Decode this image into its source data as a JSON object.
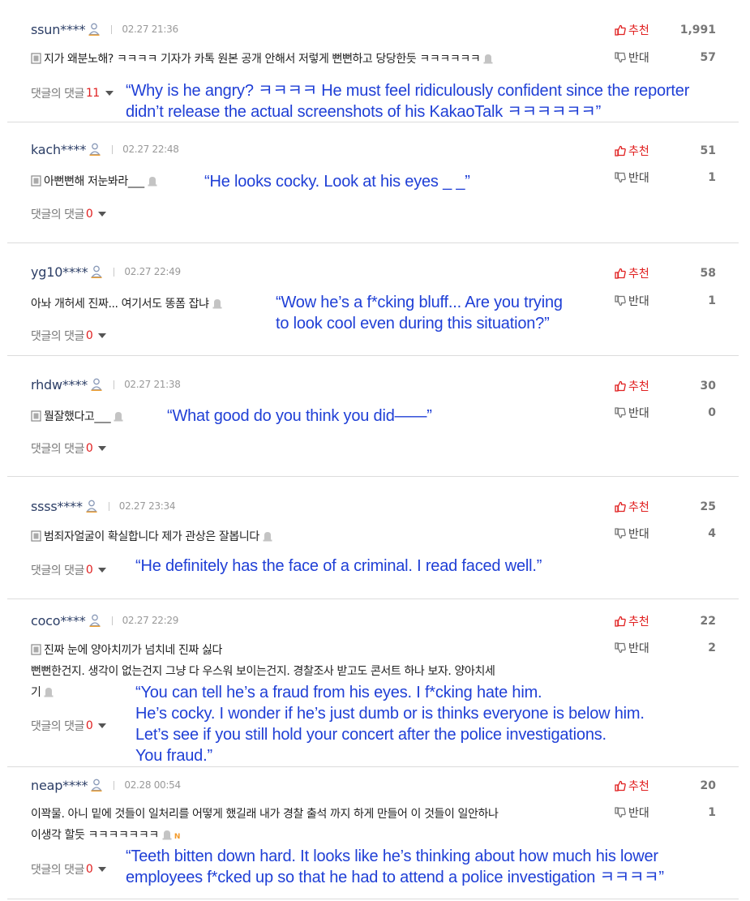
{
  "labels": {
    "recommend": "추천",
    "oppose": "반대",
    "replies": "댓글의 댓글"
  },
  "colors": {
    "username": "#2c3e66",
    "recommend": "#e02020",
    "reply_count": "#e02020",
    "translation": "#1f3fd6",
    "badge_n": "#f39a2a"
  },
  "comments": [
    {
      "user": "ssun****",
      "date": "02.27 21:36",
      "up": "1,991",
      "down": "57",
      "lines": [
        "지가 왜분노해? ㅋㅋㅋㅋ 기자가 카톡 원본 공개 안해서 저렇게 뻔뻔하고 당당한듯 ㅋㅋㅋㅋㅋㅋ"
      ],
      "replies": "11",
      "translation": [
        "“Why is he angry? ㅋㅋㅋㅋ He must feel ridiculously confident since the reporter",
        "didn’t release the actual screenshots of his KakaoTalk ㅋㅋㅋㅋㅋㅋ”"
      ]
    },
    {
      "user": "kach****",
      "date": "02.27 22:48",
      "up": "51",
      "down": "1",
      "lines": [
        "아뻔뻔해 저눈봐라___"
      ],
      "replies": "0",
      "translation": [
        "“He looks cocky. Look at  his eyes _ _”"
      ]
    },
    {
      "user": "yg10****",
      "date": "02.27 22:49",
      "up": "58",
      "down": "1",
      "lines": [
        "아놔 개허세 진짜... 여기서도 똥폼 잡냐"
      ],
      "replies": "0",
      "translation": [
        "“Wow he’s a f*cking bluff... Are you trying",
        "to look cool even during this situation?”"
      ]
    },
    {
      "user": "rhdw****",
      "date": "02.27 21:38",
      "up": "30",
      "down": "0",
      "lines": [
        "뭘잘했다고___"
      ],
      "replies": "0",
      "translation": [
        "“What good do you think you did——”"
      ]
    },
    {
      "user": "ssss****",
      "date": "02.27 23:34",
      "up": "25",
      "down": "4",
      "lines": [
        "범죄자얼굴이 확실합니다 제가 관상은 잘봅니다"
      ],
      "replies": "0",
      "translation": [
        "“He definitely has the face of a criminal. I read faced well.”"
      ]
    },
    {
      "user": "coco****",
      "date": "02.27 22:29",
      "up": "22",
      "down": "2",
      "lines": [
        "진짜 눈에 양아치끼가 넘치네 진짜 싫다",
        "뻔뻔한건지. 생각이 없는건지 그냥 다 우스워 보이는건지. 경찰조사 받고도 콘서트 하나 보자. 양아치세",
        "기"
      ],
      "replies": "0",
      "translation": [
        "“You can tell he’s a fraud from his eyes. I f*cking hate him.",
        "He’s cocky. I wonder if he’s just dumb or is thinks everyone is below him.",
        "Let’s see if you still hold your concert after the police investigations.",
        "You fraud.”"
      ]
    },
    {
      "user": "neap****",
      "date": "02.28 00:54",
      "up": "20",
      "down": "1",
      "lines": [
        "이꽉물. 아니 밑에 것들이 일처리를 어떻게 했길래 내가 경찰 출석 까지 하게 만들어 이 것들이 일안하나",
        "이생각 할듯 ㅋㅋㅋㅋㅋㅋㅋ"
      ],
      "badge": "N",
      "replies": "0",
      "translation": [
        "“Teeth bitten down hard. It looks like he’s thinking about how much his lower",
        "employees f*cked up so that he had to attend a police investigation ㅋㅋㅋㅋ”"
      ]
    }
  ]
}
